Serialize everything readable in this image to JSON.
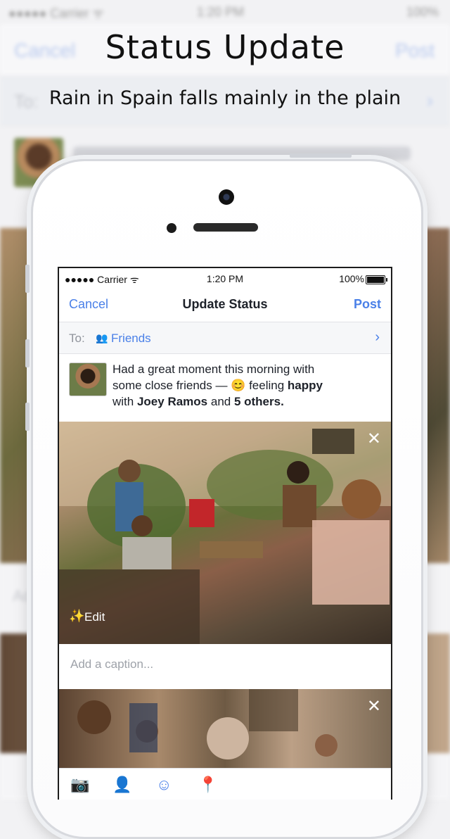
{
  "headline": "Status Update",
  "subhead": "Rain in Spain falls mainly in the plain",
  "background": {
    "carrier": "●●●●● Carrier ᯤ",
    "time": "1:20 PM",
    "battery": "100%",
    "cancel": "Cancel",
    "post": "Post",
    "to": "To:",
    "caption_hint": "Ad"
  },
  "screen": {
    "status_bar": {
      "carrier": "●●●●● Carrier ᯤ",
      "time": "1:20 PM",
      "battery": "100%"
    },
    "nav": {
      "cancel_label": "Cancel",
      "title": "Update Status",
      "post_label": "Post"
    },
    "to_row": {
      "label": "To:",
      "audience": "Friends",
      "friends_icon": "👥",
      "chevron": "›"
    },
    "post": {
      "line1": "Had a great moment this morning with",
      "line2_prefix": "some close friends — ",
      "emoji": "😊",
      "line2_feeling": " feeling ",
      "feeling": "happy",
      "line3_prefix": "with ",
      "person": "Joey Ramos",
      "line3_mid": " and ",
      "others": "5 others."
    },
    "photo1": {
      "close": "✕",
      "edit_label": "Edit",
      "edit_icon": "✨"
    },
    "caption": {
      "placeholder": "Add a caption..."
    },
    "photo2": {
      "close": "✕"
    },
    "toolbar": {
      "camera_icon": "📷",
      "tag_icon": "👤",
      "feeling_icon": "☺",
      "location_icon": "📍"
    }
  },
  "colors": {
    "accent": "#4a80e8",
    "text": "#1d2129",
    "muted": "#90949c"
  }
}
